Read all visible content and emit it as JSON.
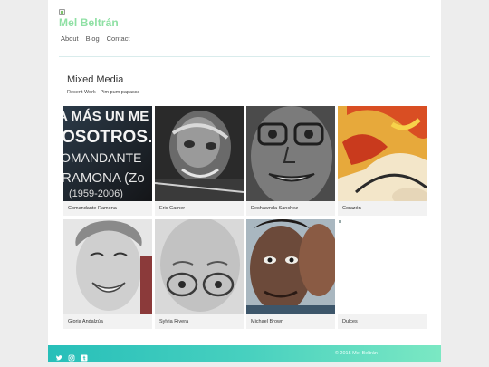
{
  "site": {
    "title": "Mel Beltrán"
  },
  "nav": {
    "items": [
      "About",
      "Blog",
      "Contact"
    ]
  },
  "section": {
    "title": "Mixed Media",
    "subtitle": "Recent Work - Pim pum papasss"
  },
  "gallery": {
    "items": [
      "Comandante Ramona",
      "Eric Garner",
      "Deshawnda Sanchez",
      "Corazón",
      "Gloria Andalzúa",
      "Sylvia Rivera",
      "Michael Brown",
      "Dulces"
    ],
    "thumb_text": [
      "A MÁS UN ME",
      "OSOTROS.'",
      "OMANDANTE",
      "RAMONA (Zo",
      "(1959-2006)"
    ]
  },
  "footer": {
    "copyright": "© 2015 Mel Beltrán",
    "social_icons": [
      "twitter-icon",
      "instagram-icon",
      "tumblr-icon"
    ]
  }
}
